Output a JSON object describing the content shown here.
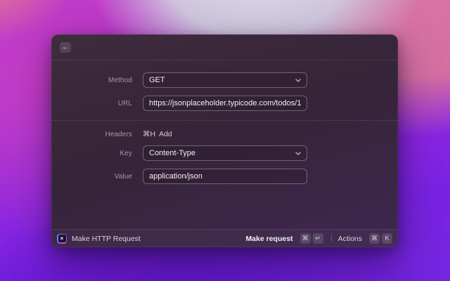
{
  "colors": {
    "wallpaper_magenta": "#c63ec6",
    "wallpaper_violet": "#7a22e2",
    "wallpaper_pink": "#d873a5",
    "wallpaper_light": "#cfc6de",
    "window_bg": "#38263c",
    "field_border": "rgba(255,255,255,0.30)",
    "app_icon_gradient": [
      "#4da3ff",
      "#8a4dff",
      "#e44dc0"
    ]
  },
  "window": {
    "back_button": {
      "icon": "←"
    },
    "form": {
      "method": {
        "label": "Method",
        "value": "GET"
      },
      "url": {
        "label": "URL",
        "value": "https://jsonplaceholder.typicode.com/todos/1"
      },
      "headers": {
        "label": "Headers",
        "shortcut": "⌘H",
        "action": "Add"
      },
      "key": {
        "label": "Key",
        "value": "Content-Type"
      },
      "value": {
        "label": "Value",
        "value": "application/json"
      }
    }
  },
  "footer": {
    "app_icon_glyph": "×",
    "app_title": "Make HTTP Request",
    "primary": {
      "label": "Make request",
      "keys": [
        "⌘",
        "↵"
      ]
    },
    "secondary": {
      "label": "Actions",
      "keys": [
        "⌘",
        "K"
      ]
    }
  }
}
